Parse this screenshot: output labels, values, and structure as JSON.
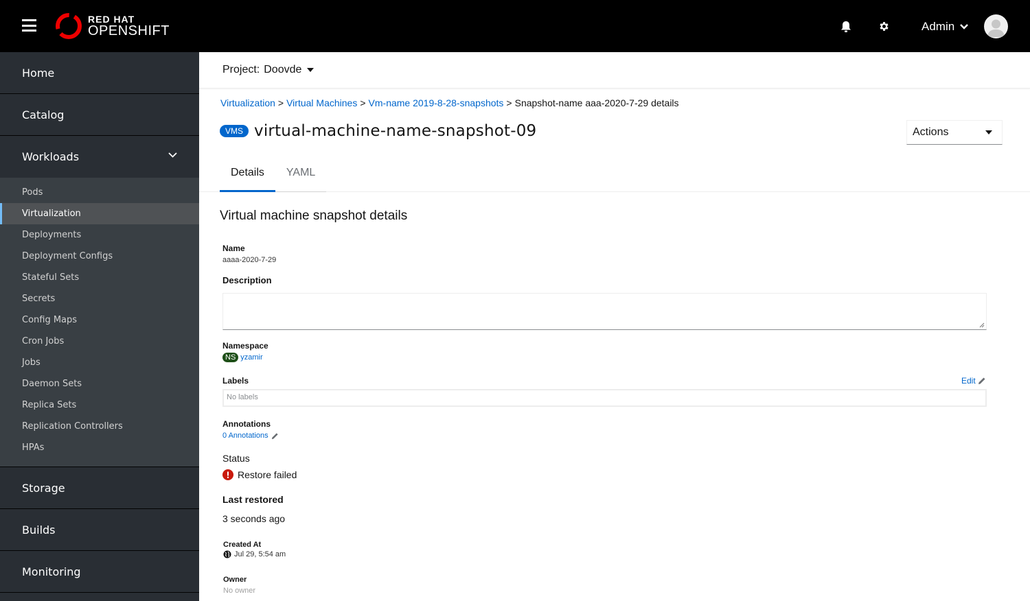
{
  "masthead": {
    "brand_line1": "RED HAT",
    "brand_line2": "OPENSHIFT",
    "user_label": "Admin"
  },
  "sidebar": {
    "sections": [
      {
        "label": "Home"
      },
      {
        "label": "Catalog"
      },
      {
        "label": "Workloads",
        "expanded": true,
        "items": [
          {
            "label": "Pods"
          },
          {
            "label": "Virtualization",
            "active": true
          },
          {
            "label": "Deployments"
          },
          {
            "label": "Deployment Configs"
          },
          {
            "label": "Stateful Sets"
          },
          {
            "label": "Secrets"
          },
          {
            "label": "Config Maps"
          },
          {
            "label": "Cron Jobs"
          },
          {
            "label": "Jobs"
          },
          {
            "label": "Daemon Sets"
          },
          {
            "label": "Replica Sets"
          },
          {
            "label": "Replication Controllers"
          },
          {
            "label": "HPAs"
          }
        ]
      },
      {
        "label": "Storage"
      },
      {
        "label": "Builds"
      },
      {
        "label": "Monitoring"
      }
    ]
  },
  "project": {
    "label": "Project:",
    "value": "Doovde"
  },
  "breadcrumb": [
    {
      "label": "Virtualization",
      "link": true
    },
    {
      "label": "Virtual Machines",
      "link": true
    },
    {
      "label": "Vm-name 2019-8-28-snapshots",
      "link": true
    },
    {
      "label": "Snapshot-name aaa-2020-7-29 details",
      "link": false
    }
  ],
  "breadcrumb_separator": ">",
  "page": {
    "badge": "VMS",
    "title": "virtual-machine-name-snapshot-09",
    "actions_label": "Actions"
  },
  "tabs": [
    {
      "label": "Details",
      "active": true
    },
    {
      "label": "YAML",
      "active": false
    }
  ],
  "details": {
    "section_title": "Virtual machine snapshot details",
    "name_label": "Name",
    "name_value": "aaaa-2020-7-29",
    "description_label": "Description",
    "description_value": "",
    "namespace_label": "Namespace",
    "namespace_badge": "NS",
    "namespace_value": "yzamir",
    "labels_label": "Labels",
    "labels_edit": "Edit",
    "labels_value": "No labels",
    "annotations_label": "Annotations",
    "annotations_value": "0 Annotations",
    "status_label": "Status",
    "status_value": "Restore failed",
    "last_restored_label": "Last restored",
    "last_restored_value": "3 seconds ago",
    "created_label": "Created At",
    "created_value": "Jul 29, 5:54 am",
    "owner_label": "Owner",
    "owner_value": "No owner"
  },
  "colors": {
    "accent": "#0066cc",
    "error": "#c9190b",
    "namespace_badge": "#1e4f18",
    "sidebar_bg": "#292e34"
  }
}
